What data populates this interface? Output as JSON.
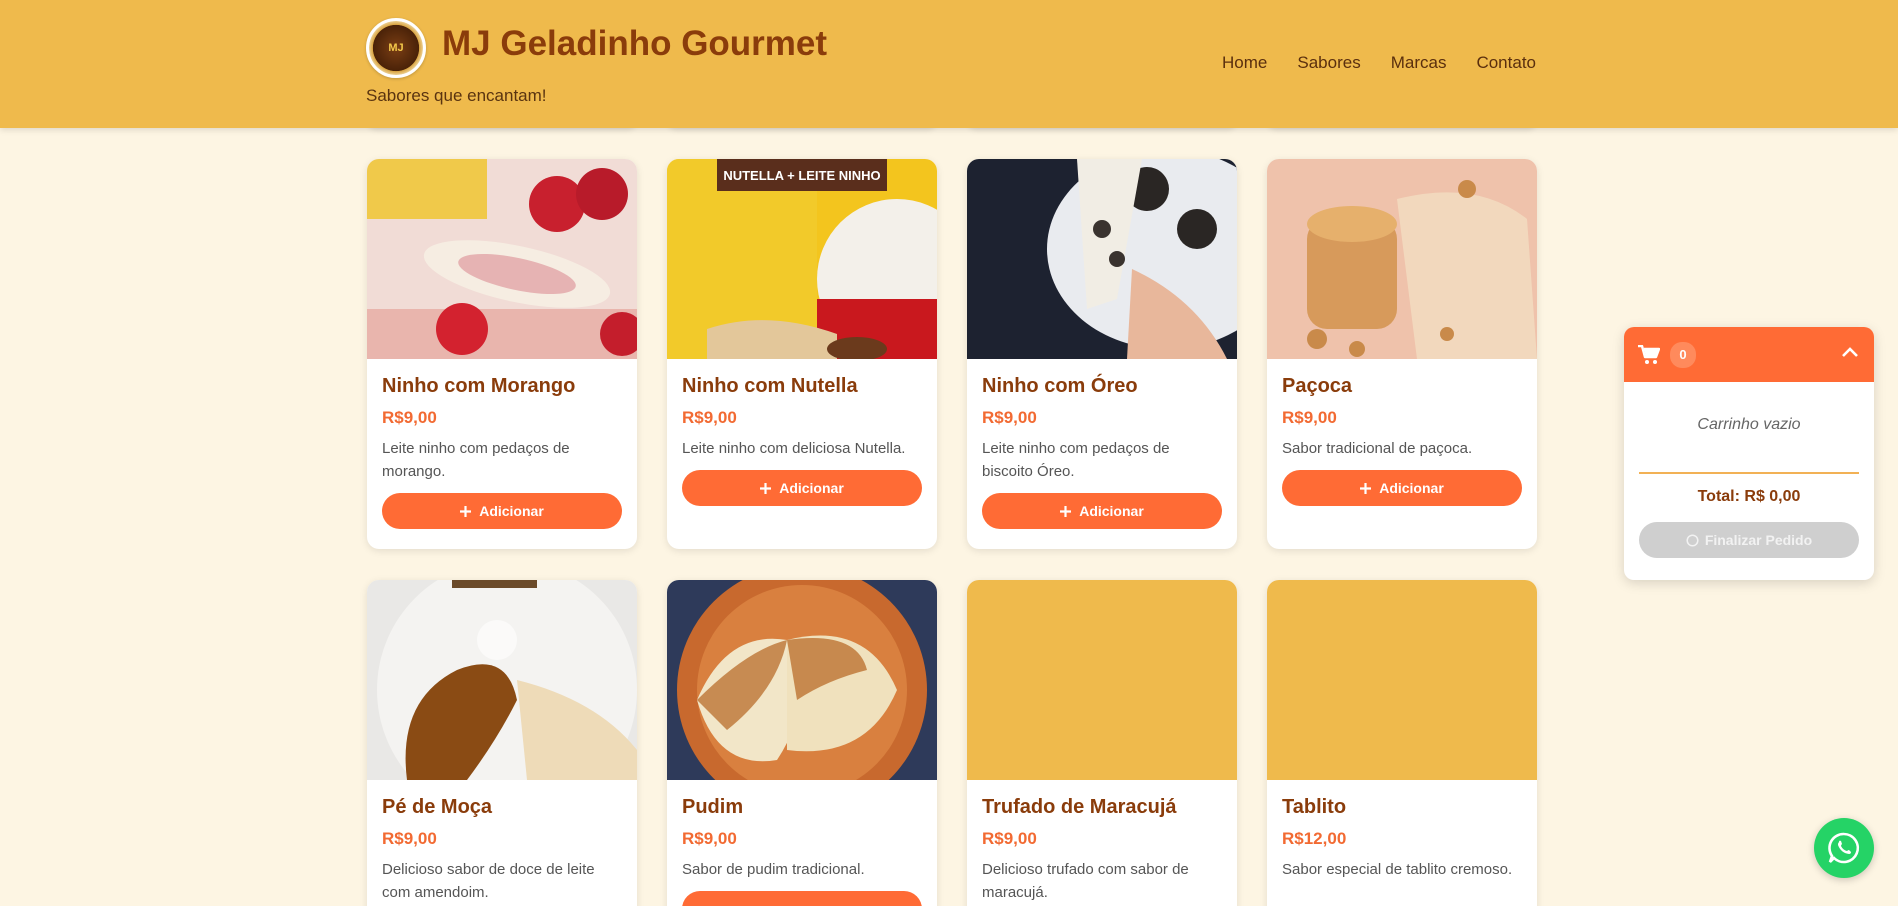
{
  "header": {
    "brand": "MJ Geladinho Gourmet",
    "tagline": "Sabores que encantam!",
    "logo_text": "MJ",
    "nav": [
      "Home",
      "Sabores",
      "Marcas",
      "Contato"
    ]
  },
  "products": [
    {
      "name": "Ninho com Morango",
      "price": "R$9,00",
      "desc": "Leite ninho com pedaços de morango.",
      "button": "Adicionar"
    },
    {
      "name": "Ninho com Nutella",
      "price": "R$9,00",
      "desc": "Leite ninho com deliciosa Nutella.",
      "button": "Adicionar",
      "banner": "NUTELLA + LEITE NINHO"
    },
    {
      "name": "Ninho com Óreo",
      "price": "R$9,00",
      "desc": "Leite ninho com pedaços de biscoito Óreo.",
      "button": "Adicionar"
    },
    {
      "name": "Paçoca",
      "price": "R$9,00",
      "desc": "Sabor tradicional de paçoca.",
      "button": "Adicionar"
    },
    {
      "name": "Pé de Moça",
      "price": "R$9,00",
      "desc": "Delicioso sabor de doce de leite com amendoim."
    },
    {
      "name": "Pudim",
      "price": "R$9,00",
      "desc": "Sabor de pudim tradicional."
    },
    {
      "name": "Trufado de Maracujá",
      "price": "R$9,00",
      "desc": "Delicioso trufado com sabor de maracujá."
    },
    {
      "name": "Tablito",
      "price": "R$12,00",
      "desc": "Sabor especial de tablito cremoso."
    }
  ],
  "cart": {
    "count": "0",
    "empty": "Carrinho vazio",
    "total": "Total: R$ 0,00",
    "finish": "Finalizar Pedido"
  },
  "colors": {
    "header_bg": "#efba4c",
    "accent": "#ff6b35",
    "brand_text": "#8a3c0b",
    "page_bg": "#fdf5e3",
    "whatsapp": "#25d366"
  },
  "icons": [
    "cart-icon",
    "chevron-up-icon",
    "plus-icon",
    "whatsapp-icon"
  ]
}
